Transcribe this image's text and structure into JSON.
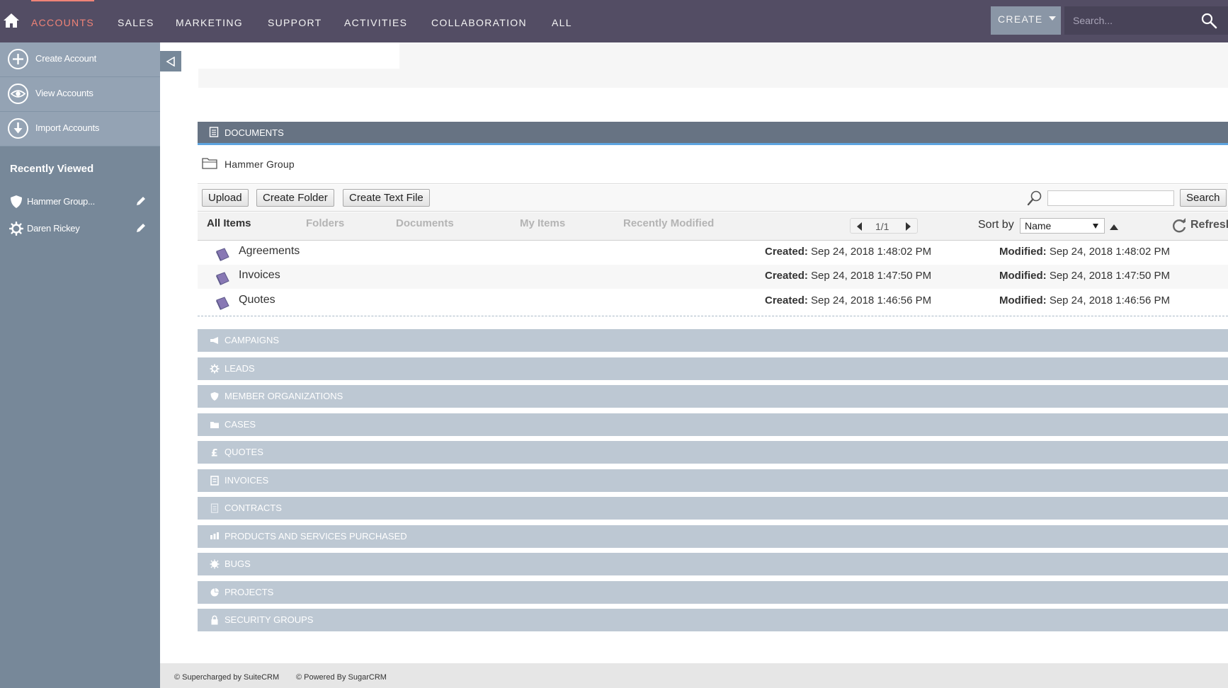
{
  "nav": {
    "items": [
      "ACCOUNTS",
      "SALES",
      "MARKETING",
      "SUPPORT",
      "ACTIVITIES",
      "COLLABORATION",
      "ALL"
    ],
    "active": "ACCOUNTS",
    "create_label": "CREATE",
    "search_placeholder": "Search...",
    "bar_color": "#534d64",
    "active_color": "#f08377"
  },
  "sidebar": {
    "actions": [
      {
        "label": "Create Account",
        "icon": "plus-circle-icon"
      },
      {
        "label": "View Accounts",
        "icon": "eye-icon"
      },
      {
        "label": "Import Accounts",
        "icon": "download-icon"
      }
    ],
    "recent_title": "Recently Viewed",
    "recent": [
      {
        "label": "Hammer Group...",
        "icon": "shield-icon"
      },
      {
        "label": "Daren Rickey",
        "icon": "gear-icon"
      }
    ]
  },
  "documents": {
    "title": "DOCUMENTS",
    "breadcrumb": "Hammer Group",
    "buttons": {
      "upload": "Upload",
      "create_folder": "Create Folder",
      "create_text_file": "Create Text File",
      "search": "Search"
    },
    "tabs": [
      "All Items",
      "Folders",
      "Documents",
      "My Items",
      "Recently Modified"
    ],
    "active_tab": "All Items",
    "page": "1/1",
    "sort_label": "Sort by",
    "sort_value": "Name",
    "refresh_label": "Refresh",
    "created_label": "Created:",
    "modified_label": "Modified:",
    "folders": [
      {
        "name": "Agreements",
        "created": "Sep 24, 2018 1:48:02 PM",
        "modified": "Sep 24, 2018 1:48:02 PM"
      },
      {
        "name": "Invoices",
        "created": "Sep 24, 2018 1:47:50 PM",
        "modified": "Sep 24, 2018 1:47:50 PM"
      },
      {
        "name": "Quotes",
        "created": "Sep 24, 2018 1:46:56 PM",
        "modified": "Sep 24, 2018 1:46:56 PM"
      }
    ]
  },
  "subpanels": [
    {
      "label": "CAMPAIGNS",
      "icon": "megaphone-icon"
    },
    {
      "label": "LEADS",
      "icon": "gear-icon"
    },
    {
      "label": "MEMBER ORGANIZATIONS",
      "icon": "shield-icon"
    },
    {
      "label": "CASES",
      "icon": "folder-icon"
    },
    {
      "label": "QUOTES",
      "icon": "pound-icon"
    },
    {
      "label": "INVOICES",
      "icon": "invoice-icon"
    },
    {
      "label": "CONTRACTS",
      "icon": "contract-icon"
    },
    {
      "label": "PRODUCTS AND SERVICES PURCHASED",
      "icon": "bar-chart-icon"
    },
    {
      "label": "BUGS",
      "icon": "bug-icon"
    },
    {
      "label": "PROJECTS",
      "icon": "pie-icon"
    },
    {
      "label": "SECURITY GROUPS",
      "icon": "lock-icon"
    }
  ],
  "footer": {
    "left": "© Supercharged by SuiteCRM",
    "right": "© Powered By SugarCRM"
  }
}
